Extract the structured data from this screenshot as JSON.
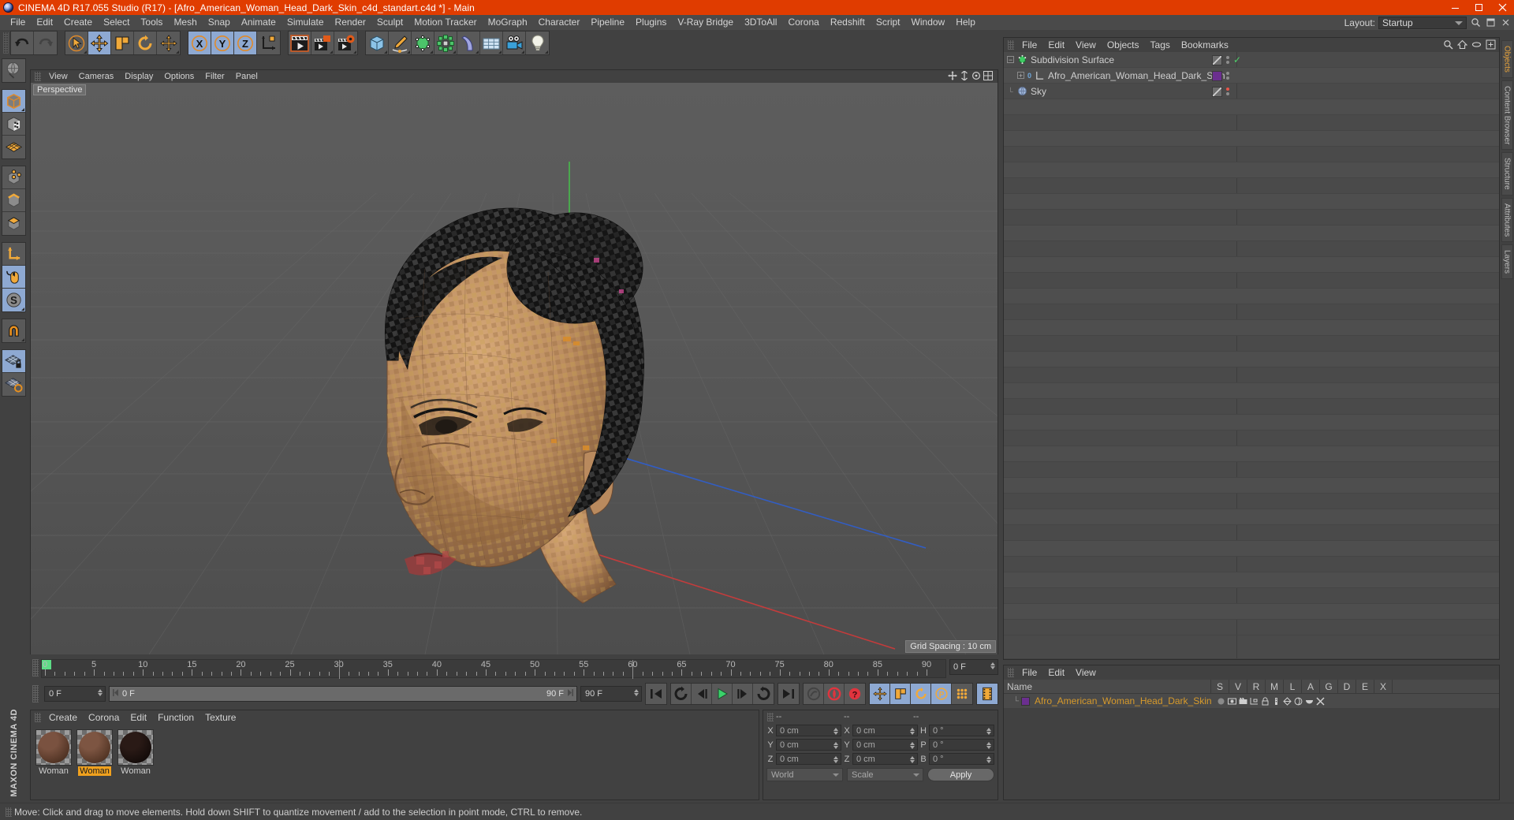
{
  "window": {
    "title": "CINEMA 4D R17.055 Studio (R17) - [Afro_American_Woman_Head_Dark_Skin_c4d_standart.c4d *] - Main",
    "accent": "#e03c00",
    "minimize": "—",
    "maximize": "☐",
    "close": "✕"
  },
  "menubar": {
    "items": [
      "File",
      "Edit",
      "Create",
      "Select",
      "Tools",
      "Mesh",
      "Snap",
      "Animate",
      "Simulate",
      "Render",
      "Sculpt",
      "Motion Tracker",
      "MoGraph",
      "Character",
      "Pipeline",
      "Plugins",
      "V-Ray Bridge",
      "3DToAll",
      "Corona",
      "Redshift",
      "Script",
      "Window",
      "Help"
    ],
    "layout_label": "Layout:",
    "layout_value": "Startup"
  },
  "viewport": {
    "menu": [
      "View",
      "Cameras",
      "Display",
      "Options",
      "Filter",
      "Panel"
    ],
    "tab": "Perspective",
    "grid_spacing": "Grid Spacing : 10 cm",
    "axis_labels": {
      "x": "X",
      "y": "Y",
      "z": "Z"
    }
  },
  "object_manager": {
    "menu": [
      "File",
      "Edit",
      "View",
      "Objects",
      "Tags",
      "Bookmarks"
    ],
    "rows": [
      {
        "name": "Subdivision Surface",
        "indent": 0,
        "icon": "subdivision-surface-icon",
        "tag": "diagonal",
        "dot": "grey",
        "check": true
      },
      {
        "name": "Afro_American_Woman_Head_Dark_Skin",
        "indent": 1,
        "icon": "polygon-object-icon",
        "badge": "0",
        "tag": "purple",
        "dot": "grey",
        "check": false
      },
      {
        "name": "Sky",
        "indent": 0,
        "icon": "sky-icon",
        "tag": "diagonal",
        "dot": "red",
        "check": false
      }
    ]
  },
  "lower_right": {
    "menu": [
      "File",
      "Edit",
      "View"
    ],
    "name_header": "Name",
    "columns": [
      "S",
      "V",
      "R",
      "M",
      "L",
      "A",
      "G",
      "D",
      "E",
      "X"
    ],
    "row_name": "Afro_American_Woman_Head_Dark_Skin"
  },
  "timeline": {
    "ticks": [
      0,
      5,
      10,
      15,
      20,
      25,
      30,
      35,
      40,
      45,
      50,
      55,
      60,
      65,
      70,
      75,
      80,
      85,
      90
    ],
    "current_frame_box": "0 F",
    "start_frame": "0 F",
    "end_frame": "90 F",
    "range_start": "0 F",
    "range_end": "90 F",
    "preview_end": "90 F"
  },
  "playback": {
    "buttons": [
      "go-to-start-icon",
      "go-to-previous-key-icon",
      "play-backwards-icon",
      "play-forwards-icon",
      "go-to-next-key-icon",
      "record-loop-icon",
      "go-to-end-icon",
      "autokey-icon",
      "record-active-objects-icon",
      "record-parameter-icon",
      "position-key-icon",
      "scale-key-icon",
      "rotation-key-icon",
      "pla-key-icon",
      "point-level-icon",
      "timeline-icon"
    ]
  },
  "materials": {
    "menu": [
      "Create",
      "Corona",
      "Edit",
      "Function",
      "Texture"
    ],
    "items": [
      {
        "label": "Woman",
        "selected": false,
        "color_a": "#7a5240",
        "color_b": "#3f2618"
      },
      {
        "label": "Woman",
        "selected": true,
        "color_a": "#7d5542",
        "color_b": "#422819"
      },
      {
        "label": "Woman",
        "selected": false,
        "color_a": "#2a1a16",
        "color_b": "#0b0605"
      }
    ]
  },
  "coordinates": {
    "headers": [
      "--",
      "--",
      "--"
    ],
    "rows": [
      {
        "a_label": "X",
        "a_value": "0 cm",
        "b_label": "X",
        "b_value": "0 cm",
        "c_label": "H",
        "c_value": "0 °"
      },
      {
        "a_label": "Y",
        "a_value": "0 cm",
        "b_label": "Y",
        "b_value": "0 cm",
        "c_label": "P",
        "c_value": "0 °"
      },
      {
        "a_label": "Z",
        "a_value": "0 cm",
        "b_label": "Z",
        "b_value": "0 cm",
        "c_label": "B",
        "c_value": "0 °"
      }
    ],
    "system": "World",
    "mode": "Scale",
    "apply": "Apply"
  },
  "statusbar": {
    "text": "Move: Click and drag to move elements. Hold down SHIFT to quantize movement / add to the selection in point mode, CTRL to remove."
  },
  "side_tabs": [
    "Objects",
    "Content Browser",
    "Structure",
    "Attributes",
    "Layers"
  ],
  "brand": "MAXON CINEMA 4D"
}
